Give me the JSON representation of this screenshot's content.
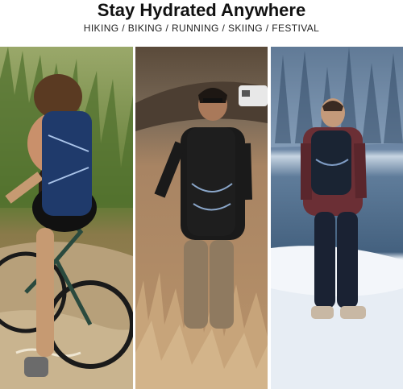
{
  "header": {
    "title": "Stay Hydrated Anywhere",
    "subtitle": "HIKING / BIKING / RUNNING / SKIING / FESTIVAL"
  },
  "panels": [
    {
      "scene": "biking"
    },
    {
      "scene": "hiking"
    },
    {
      "scene": "snow-lake"
    }
  ],
  "colors": {
    "pack_blue": "#1f3a6b",
    "grass_green": "#4f6f2c",
    "dry_grass": "#b9936a",
    "snow": "#e8eef5",
    "water": "#5f7c9a"
  }
}
